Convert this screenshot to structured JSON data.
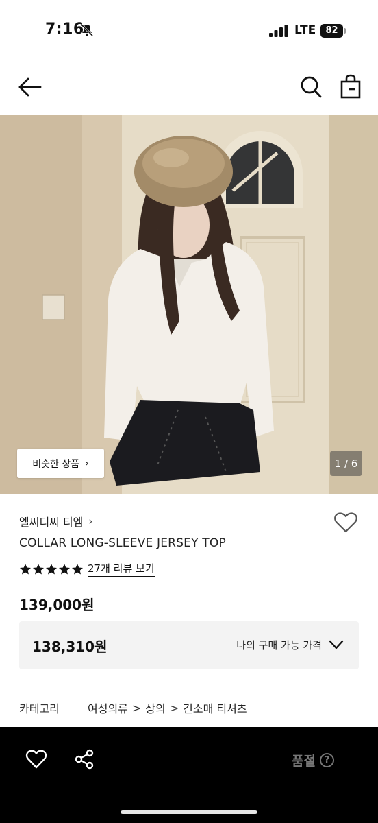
{
  "status_bar": {
    "time": "7:16",
    "network": "LTE",
    "battery": "82",
    "icons": [
      "bell-slash-icon",
      "signal-icon",
      "battery-icon"
    ]
  },
  "nav": {
    "icons": [
      "back-arrow-icon",
      "search-icon",
      "shopping-bag-icon"
    ]
  },
  "gallery": {
    "similar_label": "비슷한 상품",
    "similar_chevron": "›",
    "counter": "1 / 6"
  },
  "product": {
    "brand": "엘씨디씨 티엠",
    "brand_chevron": "›",
    "title": "COLLAR LONG-SLEEVE JERSEY TOP",
    "rating": 5,
    "review_link": "27개 리뷰 보기",
    "price": "139,000원"
  },
  "purchase": {
    "price": "138,310원",
    "label": "나의 구매 가능 가격"
  },
  "category": {
    "label": "카테고리",
    "path": [
      "여성의류",
      "상의",
      "긴소매 티셔츠"
    ],
    "separator": ">"
  },
  "bottom_bar": {
    "soldout_label": "품절",
    "help_glyph": "?",
    "icons": [
      "heart-outline-icon",
      "share-icon",
      "help-icon"
    ]
  },
  "colors": {
    "bottom_bar_bg": "#000000",
    "soldout_text": "#777777",
    "purchase_box_bg": "#f3f3f3"
  }
}
